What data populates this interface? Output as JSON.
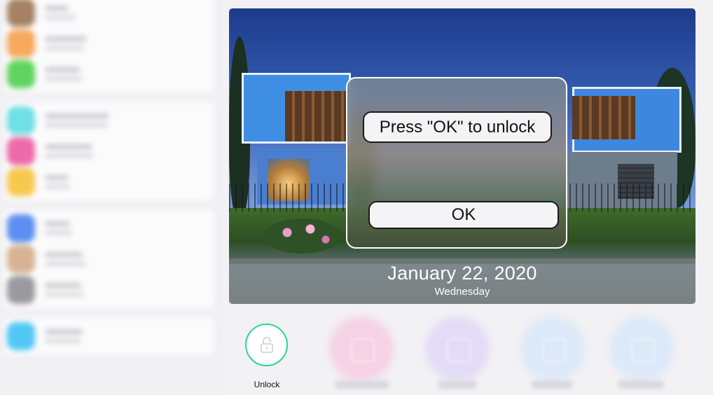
{
  "lock_screen": {
    "date": "January 22, 2020",
    "weekday": "Wednesday"
  },
  "dialog": {
    "message": "Press \"OK\" to unlock",
    "ok_label": "OK"
  },
  "actions": {
    "unlock_label": "Unlock"
  },
  "colors": {
    "unlock_accent": "#2bd49a",
    "sidebar_background": "#f1f0f3"
  },
  "icons": {
    "unlock": "padlock-icon"
  }
}
